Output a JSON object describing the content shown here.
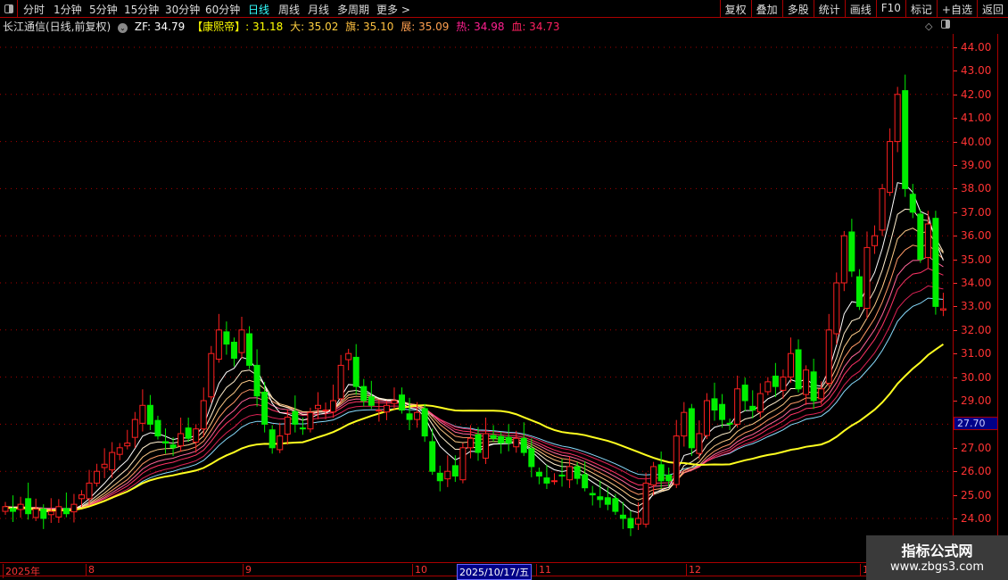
{
  "toolbar": {
    "periods": [
      {
        "label": "分时"
      },
      {
        "label": "1分钟"
      },
      {
        "label": "5分钟"
      },
      {
        "label": "15分钟"
      },
      {
        "label": "30分钟"
      },
      {
        "label": "60分钟"
      },
      {
        "label": "日线",
        "active": true
      },
      {
        "label": "周线"
      },
      {
        "label": "月线"
      },
      {
        "label": "多周期"
      },
      {
        "label": "更多 >"
      }
    ],
    "right": [
      "复权",
      "叠加",
      "多股",
      "统计",
      "画线",
      "F10",
      "标记",
      "+自选",
      "返回"
    ]
  },
  "info": {
    "stock": "长江通信(日线,前复权)",
    "zf": "ZF: 34.79",
    "kxd_label": "【康熙帝】",
    "kxd": ": 31.18",
    "da": "大: 35.02",
    "qi": "旗: 35.10",
    "zhan": "展: 35.09",
    "re": "热: 34.98",
    "xue": "血: 34.73"
  },
  "colors": {
    "up": "#ff2020",
    "down": "#00ee00",
    "ma_long": "#ffff20",
    "info_yellow": "#ffff00",
    "info_orange": "#ffb040",
    "info_pink": "#ff2080"
  },
  "chart_data": {
    "type": "candlestick",
    "ylim": [
      23.5,
      44.5
    ],
    "yticks": [
      "44.00",
      "43.00",
      "42.00",
      "41.00",
      "40.00",
      "39.00",
      "38.00",
      "37.00",
      "36.00",
      "35.00",
      "34.00",
      "33.00",
      "32.00",
      "31.00",
      "30.00",
      "29.00",
      "28.00",
      "27.00",
      "26.00",
      "25.00",
      "24.00"
    ],
    "closes": [
      24.5,
      24.3,
      24.6,
      24.2,
      24.4,
      24.0,
      24.3,
      24.5,
      24.2,
      24.6,
      25.0,
      25.5,
      26.0,
      26.3,
      26.8,
      27.0,
      27.2,
      28.2,
      28.8,
      28.0,
      27.5,
      27.2,
      27.0,
      27.6,
      27.4,
      27.8,
      29.0,
      31.0,
      32.0,
      31.4,
      30.8,
      32.0,
      30.5,
      29.2,
      28.0,
      27.0,
      27.5,
      28.3,
      28.0,
      27.8,
      28.5,
      28.8,
      28.6,
      29.0,
      30.5,
      31.0,
      29.6,
      29.0,
      28.8,
      28.6,
      28.8,
      29.0,
      28.6,
      28.2,
      28.5,
      27.5,
      26.0,
      25.6,
      26.0,
      25.8,
      27.0,
      27.4,
      26.8,
      27.6,
      27.4,
      27.2,
      27.2,
      27.4,
      26.8,
      26.2,
      25.8,
      25.5,
      25.6,
      25.8,
      26.2,
      25.7,
      25.3,
      25.0,
      24.8,
      24.6,
      24.3,
      24.0,
      23.6,
      24.0,
      25.5,
      26.2,
      25.6,
      25.6,
      27.5,
      28.5,
      27.0,
      27.6,
      29.0,
      28.6,
      28.2,
      28.0,
      29.5,
      29.0,
      28.6,
      29.3,
      29.8,
      29.6,
      30.0,
      31.0,
      29.5,
      30.3,
      29.0,
      29.5,
      32.0,
      34.0,
      36.0,
      34.5,
      33.0,
      35.5,
      36.0,
      38.0,
      40.0,
      42.0,
      38.0,
      37.0,
      35.0,
      36.5,
      33.0,
      32.9
    ]
  },
  "price_marker": "27.70",
  "time_axis": {
    "labels": [
      "2025年",
      "8",
      "9",
      "10",
      "11",
      "12",
      "1"
    ],
    "current": "2025/10/17/五"
  },
  "watermark": {
    "line1": "指标公式网",
    "line2": "www.zbgs3.com"
  }
}
